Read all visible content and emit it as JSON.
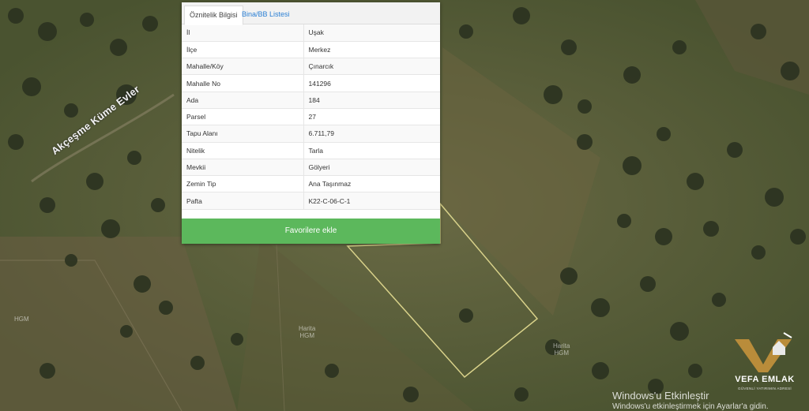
{
  "tabs": {
    "active": "Öznitelik Bilgisi",
    "second": "Bina/BB Listesi"
  },
  "attributes": [
    {
      "key": "İl",
      "value": "Uşak"
    },
    {
      "key": "İlçe",
      "value": "Merkez"
    },
    {
      "key": "Mahalle/Köy",
      "value": "Çınarcık"
    },
    {
      "key": "Mahalle No",
      "value": "141296"
    },
    {
      "key": "Ada",
      "value": "184"
    },
    {
      "key": "Parsel",
      "value": "27"
    },
    {
      "key": "Tapu Alanı",
      "value": "6.711,79"
    },
    {
      "key": "Nitelik",
      "value": "Tarla"
    },
    {
      "key": "Mevkii",
      "value": "Gölyeri"
    },
    {
      "key": "Zemin Tip",
      "value": "Ana Taşınmaz"
    },
    {
      "key": "Pafta",
      "value": "K22-C-06-C-1"
    }
  ],
  "favorite_button": "Favorilere ekle",
  "map": {
    "road_label": "Akçeşme Küme Evler",
    "watermarks": [
      "HGM",
      "Harita\nHGM",
      "Harita\nHGM"
    ],
    "parcel_color": "#d9d28a"
  },
  "logo": {
    "title": "VEFA EMLAK",
    "subtitle": "GÜVENLİ YATIRIMIN ADRESİ"
  },
  "windows_activation": {
    "title": "Windows'u Etkinleştir",
    "message": "Windows'u etkinleştirmek için Ayarlar'a gidin."
  }
}
